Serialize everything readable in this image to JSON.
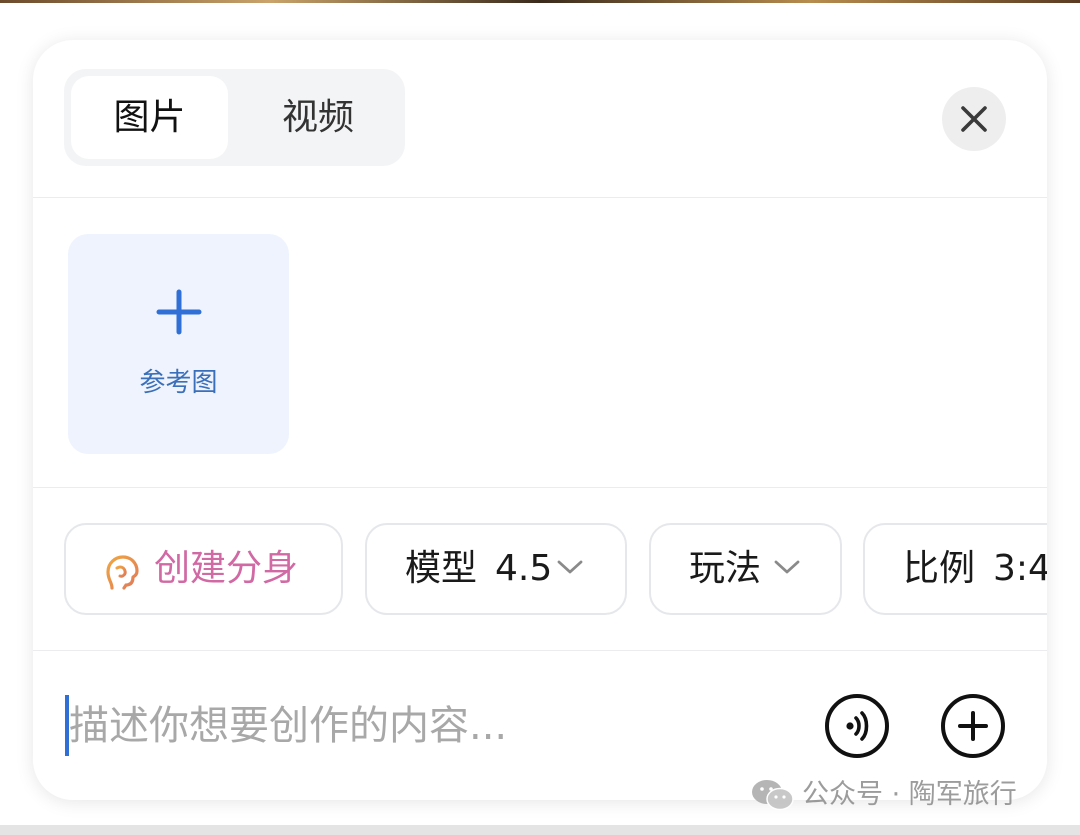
{
  "tabs": [
    {
      "label": "图片",
      "active": true
    },
    {
      "label": "视频",
      "active": false
    }
  ],
  "reference": {
    "label": "参考图"
  },
  "chips": {
    "avatar": {
      "label": "创建分身",
      "color": "#d169a4"
    },
    "model": {
      "label": "模型",
      "value": "4.5"
    },
    "play": {
      "label": "玩法"
    },
    "ratio": {
      "label": "比例",
      "value": "3:4"
    }
  },
  "prompt": {
    "placeholder": "描述你想要创作的内容..."
  },
  "watermark": {
    "text": "公众号 · 陶军旅行"
  },
  "colors": {
    "accent": "#2f6fd6",
    "reference_bg": "#eef3fe",
    "reference_text": "#3a6fb9"
  }
}
